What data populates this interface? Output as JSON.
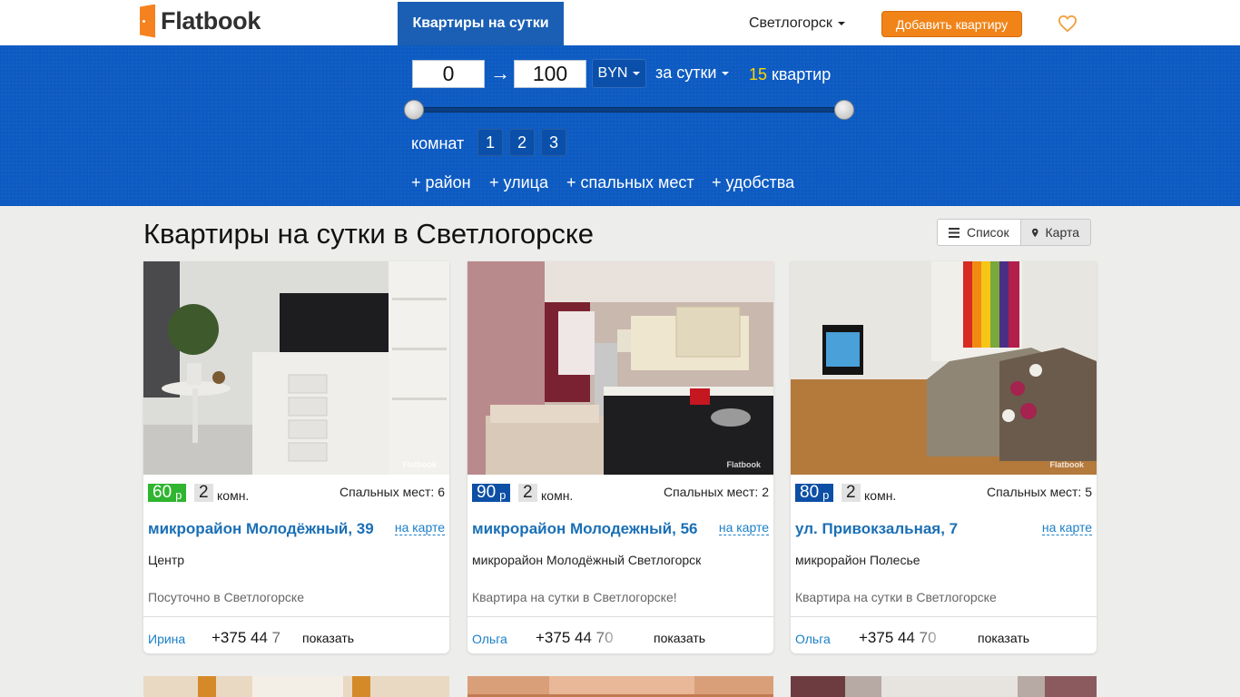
{
  "nav": {
    "brand": "Flatbook",
    "tab": "Квартиры на сутки",
    "city": "Светлогорск",
    "add_button": "Добавить квартиру"
  },
  "filter": {
    "price_min": "0",
    "price_max": "100",
    "arrow": "→",
    "currency": "BYN",
    "period": "за сутки",
    "count_num": "15",
    "count_label": "квартир",
    "rooms_label": "комнат",
    "rooms": [
      "1",
      "2",
      "3"
    ],
    "extras": [
      "+ район",
      "+ улица",
      "+ спальных мест",
      "+ удобства"
    ]
  },
  "page": {
    "title": "Квартиры на сутки в Светлогорске",
    "view_list": "Список",
    "view_map": "Карта"
  },
  "listings": [
    {
      "price": "60",
      "currency": "р",
      "price_color": "#2fb52f",
      "rooms": "2",
      "rooms_label": "комн.",
      "beds": "Спальных мест: 6",
      "address": "микрорайон Молодёжный, 39",
      "map_link": "на карте",
      "district": "Центр",
      "description": "Посуточно в Светлогорске",
      "owner": "Ирина",
      "phone": "+375 44 7",
      "show": "показать",
      "watermark": "Flatbook"
    },
    {
      "price": "90",
      "currency": "р",
      "price_color": "#0d4fa5",
      "rooms": "2",
      "rooms_label": "комн.",
      "beds": "Спальных мест: 2",
      "address": "микрорайон Молодежный, 56",
      "map_link": "на карте",
      "district": "микрорайон Молодёжный Светлогорск",
      "description": "Квартира на сутки в Светлогорске!",
      "owner": "Ольга",
      "phone": "+375 44 70",
      "show": "показать",
      "watermark": "Flatbook"
    },
    {
      "price": "80",
      "currency": "р",
      "price_color": "#0d4fa5",
      "rooms": "2",
      "rooms_label": "комн.",
      "beds": "Спальных мест: 5",
      "address": "ул. Привокзальная, 7",
      "map_link": "на карте",
      "district": "микрорайон Полесье",
      "description": "Квартира на сутки в Светлогорске",
      "owner": "Ольга",
      "phone": "+375 44 70",
      "show": "показать",
      "watermark": "Flatbook"
    }
  ],
  "colors": {
    "brand_orange": "#f5821f",
    "filter_blue": "#0d5bc2",
    "link_blue": "#1a6fb5"
  }
}
